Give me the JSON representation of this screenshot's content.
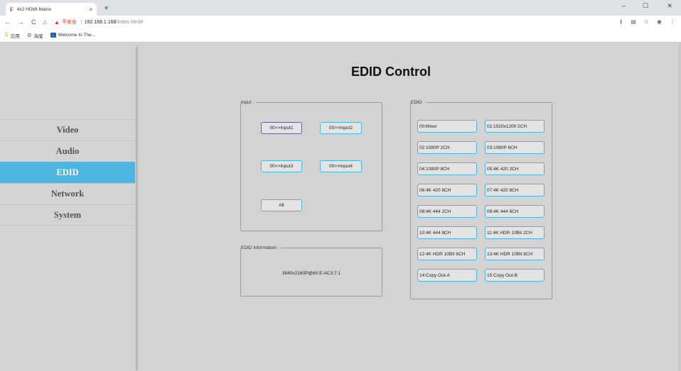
{
  "browser": {
    "tab_title": "4x2 HDMI Matrix",
    "favicon": "F",
    "tab_close": "×",
    "new_tab": "+",
    "nav_back": "←",
    "nav_forward": "→",
    "nav_reload": "C",
    "nav_home": "⌂",
    "insecure_label": "不安全",
    "url_sep": "|",
    "url_host": "192.168.1.168",
    "url_path": "/index.html#",
    "bookmarks": [
      {
        "label": "应用",
        "icon": "apps-grid-icon"
      },
      {
        "label": "淘宝",
        "icon": "blocked-icon"
      },
      {
        "label": "Welcome to The...",
        "icon": "site-favicon-icon"
      }
    ]
  },
  "sidebar": {
    "items": [
      {
        "label": "Video",
        "active": false
      },
      {
        "label": "Audio",
        "active": false
      },
      {
        "label": "EDID",
        "active": true
      },
      {
        "label": "Network",
        "active": false
      },
      {
        "label": "System",
        "active": false
      }
    ]
  },
  "main": {
    "title": "EDID Control",
    "input_panel": {
      "legend": "Input :",
      "buttons": [
        "00>>Input1",
        "00>>Input2",
        "00>>Input3",
        "00>>Input4",
        "All"
      ]
    },
    "info_panel": {
      "legend": "EDID Information :",
      "text": "3840x2160P@60 E-AC3:7.1"
    },
    "edid_panel": {
      "legend": "EDID :",
      "options": [
        "00:Mixer",
        "01:1920x1200 2CH",
        "02:1080P 2CH",
        "03:1080P 6CH",
        "04:1080P 8CH",
        "05:4K 420 2CH",
        "06:4K 420 6CH",
        "07:4K 420 8CH",
        "08:4K 444 2CH",
        "09:4K 444 6CH",
        "10:4K 444 8CH",
        "11:4K HDR 10Bit 2CH",
        "12:4K HDR 10Bit 6CH",
        "13:4K HDR 10Bit 8CH",
        "14:Copy Out-A",
        "15:Copy Out-B"
      ]
    }
  },
  "colors": {
    "accent": "#4db6e0",
    "button_border": "#4fb3de",
    "selected_border": "#6a5f9e",
    "page_bg": "#d3d3d3"
  }
}
